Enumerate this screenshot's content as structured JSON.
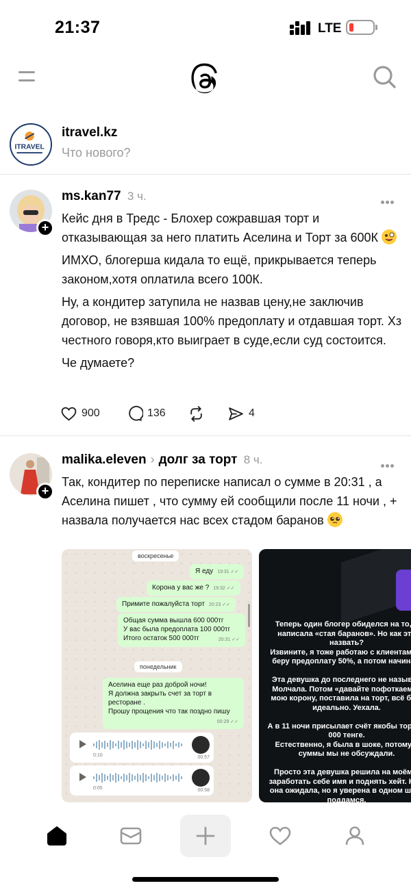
{
  "status_bar": {
    "time": "21:37",
    "network": "LTE",
    "battery_color": "#ff3b30"
  },
  "header": {
    "menu_icon": "menu-icon",
    "logo_icon": "threads-logo-icon",
    "search_icon": "search-icon"
  },
  "compose": {
    "username": "itravel.kz",
    "placeholder": "Что нового?",
    "avatar_text": "iTRAVEL"
  },
  "posts": [
    {
      "username": "ms.kan77",
      "time": "3 ч.",
      "paragraphs": [
        "Кейс дня в Тредс - Блохер сожравшая торт и отказывающая за него платить Аселина и Торт за 600К",
        "ИМХО, блогерша кидала то ещё, прикрывается теперь законом,хотя оплатила всего 100К.",
        "Ну, а кондитер затупила не назвав цену,не заключив договор, не взявшая 100% предоплату и отдавшая торт. Хз честного говоря,кто выиграет в суде,если суд состоится.",
        "Че думаете?"
      ],
      "likes": "900",
      "replies": "136",
      "shares": "4"
    },
    {
      "username": "malika.eleven",
      "topic": "долг за торт",
      "time": "8 ч.",
      "text": "Так, кондитер по переписке написал  о сумме в 20:31 , а Аселина пишет , что сумму ей сообщили после 11 ночи , + назвала получается нас всех стадом баранов",
      "chat": {
        "day1": "воскресенье",
        "msg1": "Я еду",
        "msg1_time": "19:31",
        "msg2": "Корона у вас же ?",
        "msg2_time": "19:32",
        "msg3": "Примите пожалуйста торт",
        "msg3_time": "20:23",
        "msg4_lines": [
          "Общая сумма вышла 600 000тг",
          "У вас была предоплата 100 000тг",
          "Итого остаток 500 000тг"
        ],
        "msg4_time": "20:31",
        "day2": "понедельник",
        "msg5_lines": [
          "Аселина еще раз доброй ночи!",
          "Я должна закрыть счет за торт в ресторане .",
          "Прошу прощения что так поздно пишу"
        ],
        "msg5_time": "00:29",
        "voice1_dur": "0:10",
        "voice1_time": "00:57",
        "voice2_dur": "0:05",
        "voice2_time": "00:58"
      },
      "story_text": "Теперь один блогер обиделся на то, ч\nнаписала «стая баранов». Но как это\nназвать?\nИзвините, я тоже работаю с клиентами и\nберу предоплату 50%, а потом начинаю\n\nЭта девушка до последнего не называл\nМолчала. Потом «давайте пофоткаемся\nмою корону, поставила на торт, всё был\nидеально. Уехала.\n\nА в 11 ночи присылает счёт якобы торт ст\n000 тенге.\nЕстественно, я была в шоке, потому ч\nсуммы мы не обсуждали.\n\nПросто эта девушка решила на моём и\nзаработать себе имя и поднять хейт. Не з\nона ожидала, но я уверена в одном шант\nподдамся.\n\nЯ буду идти до конца. Я выдержу всех"
    }
  ],
  "tabbar": {
    "items": [
      "home-icon",
      "inbox-icon",
      "create-icon",
      "activity-icon",
      "profile-icon"
    ]
  },
  "colors": {
    "accent": "#000000",
    "secondary_text": "#9a9a9a",
    "bubble_green": "#d9fdd3",
    "check_blue": "#53bdeb"
  }
}
